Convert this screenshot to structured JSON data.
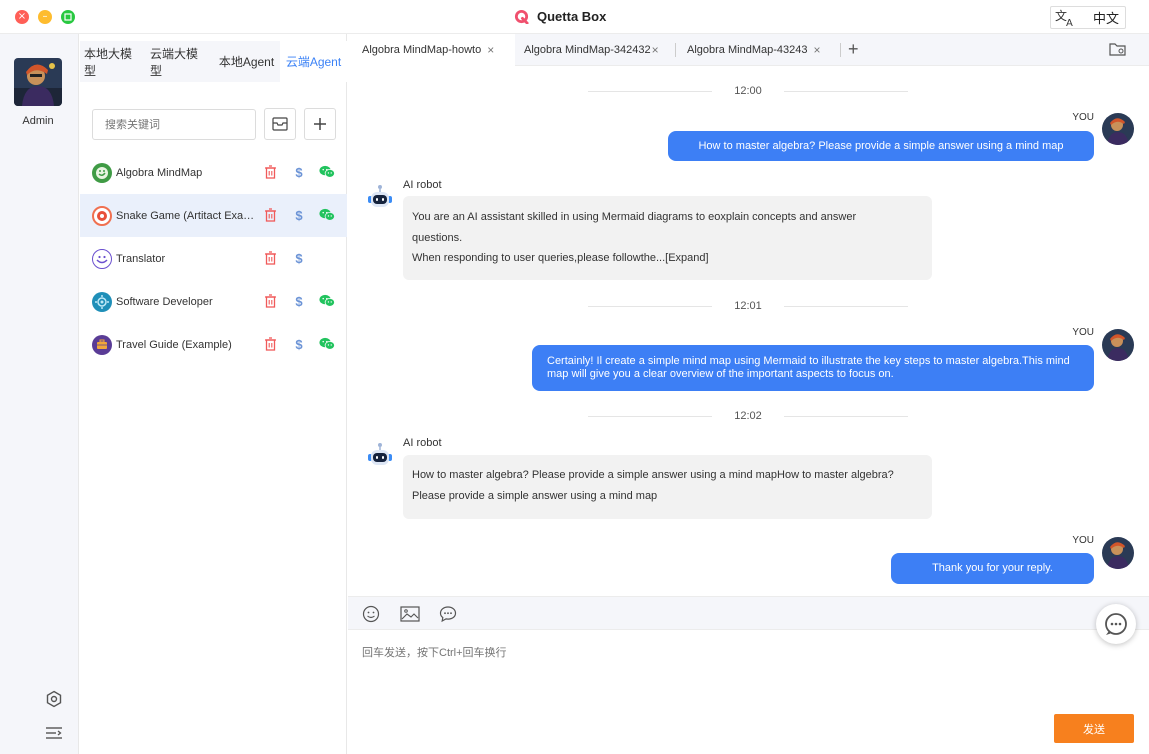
{
  "window": {
    "title": "Quetta Box",
    "language": {
      "icon": "translate-icon",
      "label": "中文"
    }
  },
  "user": {
    "name": "Admin"
  },
  "sidebar_tabs": [
    {
      "label": "本地大模型",
      "active": false
    },
    {
      "label": "云端大模型",
      "active": false
    },
    {
      "label": "本地Agent",
      "active": false
    },
    {
      "label": "云端Agent",
      "active": true
    }
  ],
  "search": {
    "placeholder": "搜索关键词"
  },
  "agents": [
    {
      "name": "Algobra MindMap",
      "selected": false,
      "has_wechat": true
    },
    {
      "name": "Snake Game (Artitact Example)",
      "selected": true,
      "has_wechat": true
    },
    {
      "name": "Translator",
      "selected": false,
      "has_wechat": false
    },
    {
      "name": "Software Developer",
      "selected": false,
      "has_wechat": true
    },
    {
      "name": "Travel Guide (Example)",
      "selected": false,
      "has_wechat": true
    }
  ],
  "agent_actions": {
    "price_symbol": "$"
  },
  "chat_tabs": [
    {
      "label": "Algobra MindMap-howto",
      "active": true
    },
    {
      "label": "Algobra MindMap-342432",
      "active": false
    },
    {
      "label": "Algobra MindMap-43243",
      "active": false
    }
  ],
  "messages": {
    "t1": "12:00",
    "you1_label": "YOU",
    "you1_text": "How to master algebra? Please provide a simple answer using a mind map",
    "ai1_label": "AI robot",
    "ai1_line1": "You are an AI assistant skilled in using Mermaid diagrams to eoxplain concepts and answer",
    "ai1_line2": "questions.",
    "ai1_line3": "When responding to user queries,please followthe...[Expand]",
    "t2": "12:01",
    "you2_label": "YOU",
    "you2_text": "Certainly! Il create a simple mind map using Mermaid to illustrate the key steps to master algebra.This mind map will give you a clear overview of the important aspects to focus on.",
    "t3": "12:02",
    "ai2_label": "AI robot",
    "ai2_line1": "How to master algebra? Please provide a simple answer using a mind mapHow to master algebra?",
    "ai2_line2": "Please provide a simple answer using a mind map",
    "you3_label": "YOU",
    "you3_text": "Thank you for your reply."
  },
  "composer": {
    "placeholder": "回车发送，按下Ctrl+回车换行",
    "send_label": "发送"
  },
  "colors": {
    "accent": "#3d7ff5",
    "send": "#f7801e",
    "delete": "#f05a5a",
    "wechat": "#22c35e"
  }
}
